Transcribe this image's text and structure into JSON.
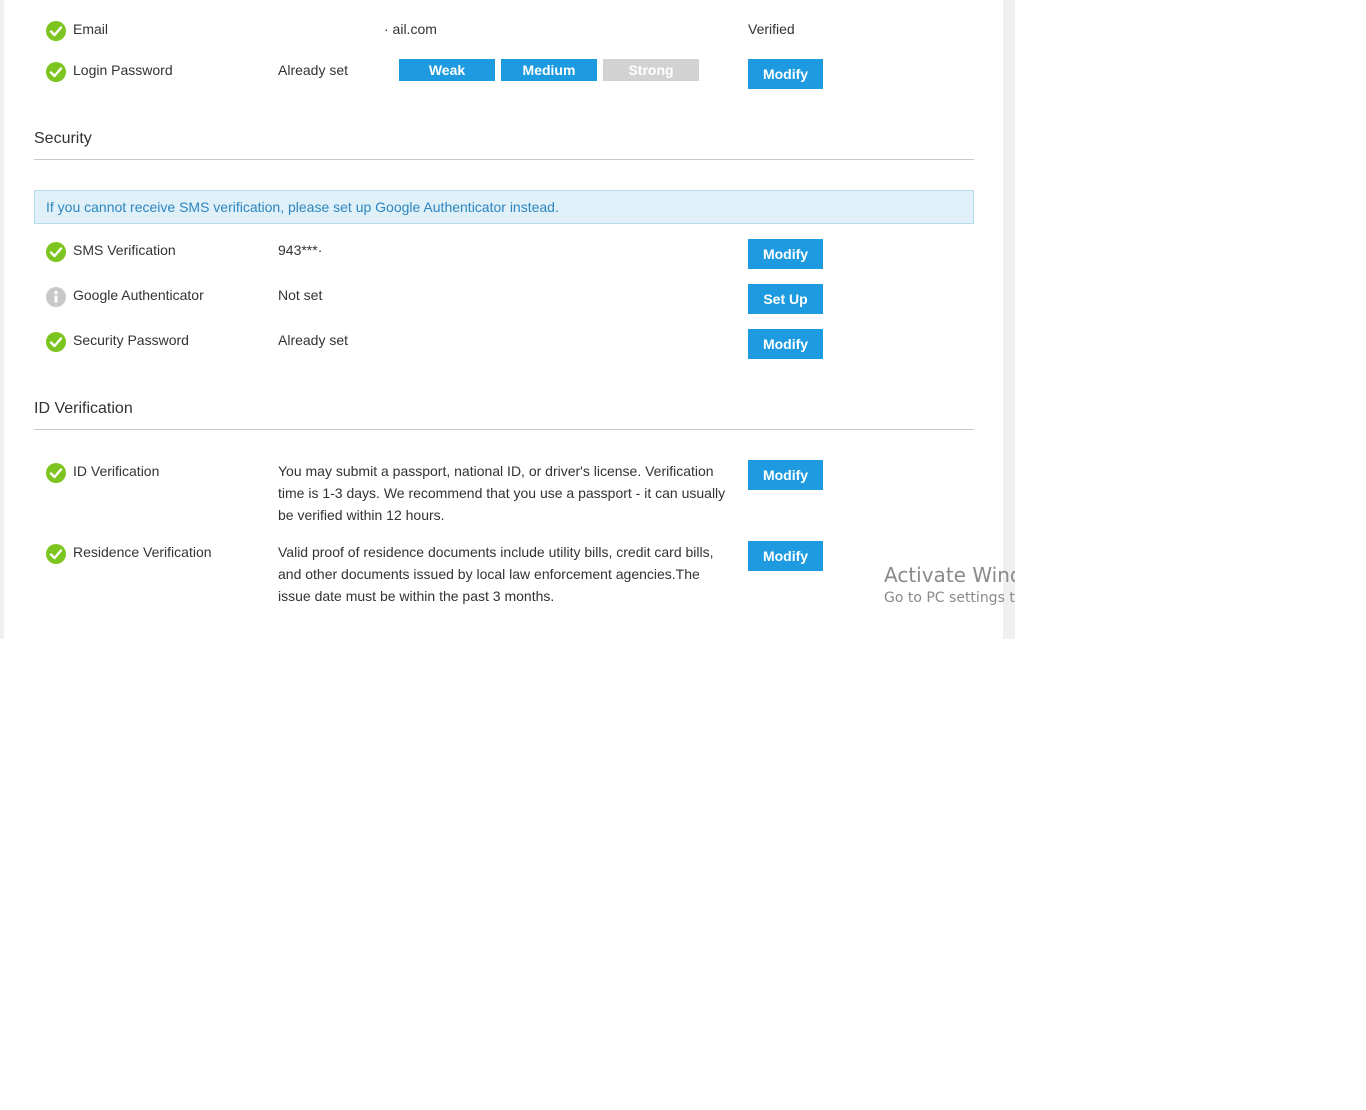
{
  "colors": {
    "check_green": "#7cc41f",
    "info_gray": "#c8c8c8",
    "button_blue": "#1e9be0",
    "strength_inactive": "#d2d2d2",
    "notice_text": "#2d86c0",
    "notice_bg": "#dff0f9"
  },
  "account": {
    "email": {
      "label": "Email",
      "value": "·          ail.com",
      "status": "Verified",
      "icon": "check-circle-icon"
    },
    "login_password": {
      "label": "Login Password",
      "value": "Already set",
      "strength": {
        "weak": "Weak",
        "medium": "Medium",
        "strong": "Strong",
        "level": "Medium"
      },
      "button": "Modify",
      "icon": "check-circle-icon"
    }
  },
  "security": {
    "title": "Security",
    "notice": "If you cannot receive SMS verification, please set up Google Authenticator instead.",
    "sms": {
      "label": "SMS Verification",
      "value": "943***·",
      "button": "Modify",
      "icon": "check-circle-icon"
    },
    "google_auth": {
      "label": "Google Authenticator",
      "value": "Not set",
      "button": "Set Up",
      "icon": "info-circle-icon"
    },
    "security_password": {
      "label": "Security Password",
      "value": "Already set",
      "button": "Modify",
      "icon": "check-circle-icon"
    }
  },
  "id_verification": {
    "title": "ID Verification",
    "id": {
      "label": "ID Verification",
      "description": "You may submit a passport, national ID, or driver's license. Verification time is 1-3 days. We recommend that you use a passport - it can usually be verified within 12 hours.",
      "button": "Modify",
      "icon": "check-circle-icon"
    },
    "residence": {
      "label": "Residence Verification",
      "description": "Valid proof of residence documents include utility bills, credit card bills, and other documents issued by local law enforcement agencies.The issue date must be within the past 3 months.",
      "button": "Modify",
      "icon": "check-circle-icon"
    }
  },
  "watermark": {
    "line1": "Activate Windows",
    "line2": "Go to PC settings to activate Windows."
  }
}
